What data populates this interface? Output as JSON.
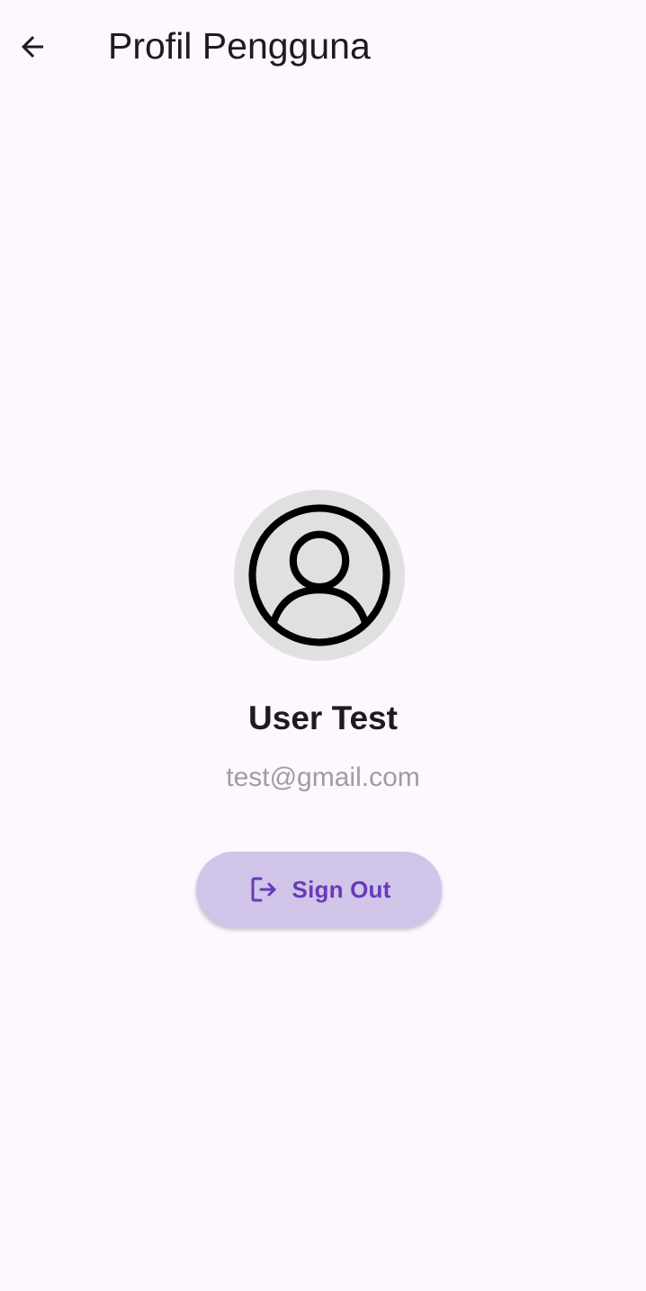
{
  "header": {
    "title": "Profil Pengguna",
    "back_icon": "arrow-back-icon"
  },
  "profile": {
    "avatar_icon": "account-circle-icon",
    "name": "User Test",
    "email": "test@gmail.com"
  },
  "actions": {
    "sign_out_label": "Sign Out",
    "sign_out_icon": "logout-icon"
  },
  "colors": {
    "background": "#fdf7ff",
    "avatar_background": "#e0e0e0",
    "button_background": "#d1c4e9",
    "accent": "#673ab7",
    "email_text": "#9e9e9e"
  }
}
